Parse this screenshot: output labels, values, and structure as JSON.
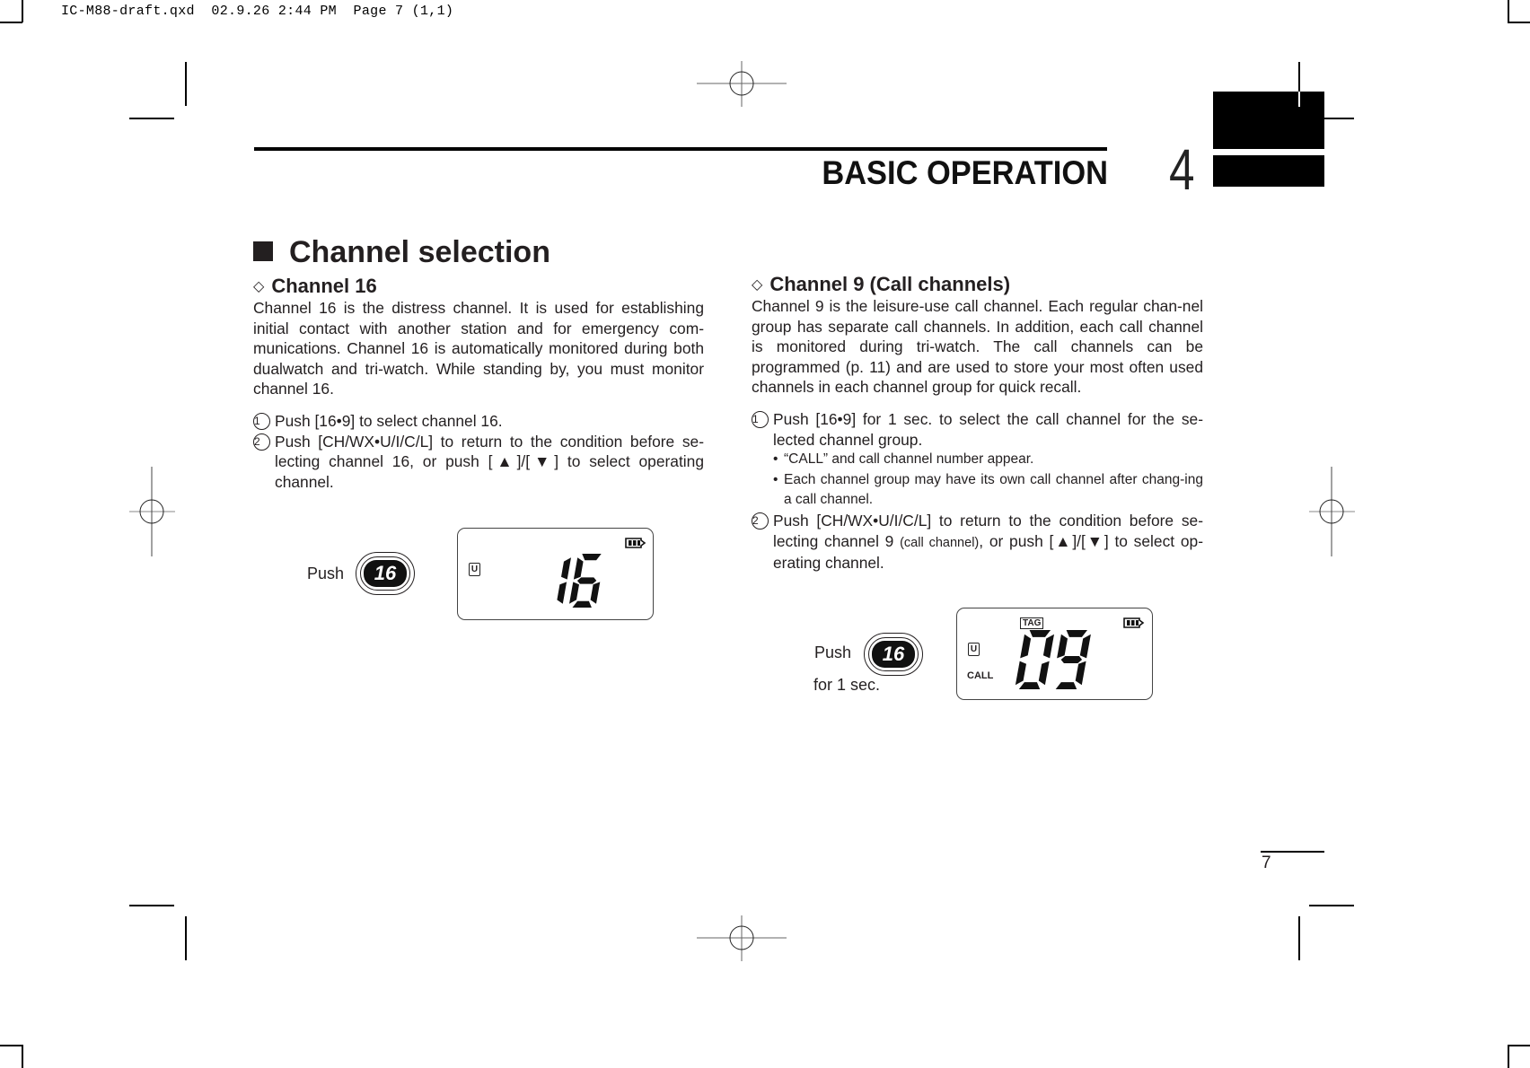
{
  "slug": "IC-M88-draft.qxd  02.9.26 2:44 PM  Page 7 (1,1)",
  "header": {
    "title": "BASIC OPERATION",
    "chapter_number": "4"
  },
  "section": {
    "title": "Channel selection",
    "icon": "square-bullet-icon"
  },
  "left_column": {
    "subhead": "Channel 16",
    "subhead_icon": "diamond-icon",
    "paragraph": "Channel 16 is the distress channel. It is used for establishing initial contact with another station and for emergency com-munications. Channel 16 is automatically monitored during both dualwatch and tri-watch. While standing by, you must monitor channel 16.",
    "steps": [
      {
        "num": "1",
        "text": "Push [16•9] to select channel 16."
      },
      {
        "num": "2",
        "text": "Push [CH/WX•U/I/C/L] to return to the condition before se-lecting channel 16, or push [▲]/[▼] to select operating channel."
      }
    ],
    "illustration": {
      "push_label": "Push",
      "key_label": "16",
      "lcd": {
        "digits": "16",
        "mode_indicator": "U",
        "battery_icon": "battery-icon"
      }
    }
  },
  "right_column": {
    "subhead": "Channel 9 (Call channels)",
    "subhead_icon": "diamond-icon",
    "paragraph": "Channel 9 is the leisure-use call channel. Each regular chan-nel group has separate call channels. In addition, each call channel is monitored during tri-watch. The call channels can be programmed (p. 11) and are used to store your most often used channels in each channel group for quick recall.",
    "steps": [
      {
        "num": "1",
        "text": "Push [16•9] for 1 sec. to select the call channel for the se-lected channel group.",
        "bullets": [
          "“CALL” and call channel number appear.",
          "Each channel group may have its own call channel after chang-ing a call channel."
        ]
      },
      {
        "num": "2",
        "text_before": "Push [CH/WX•U/I/C/L] to return to the condition before se-lecting channel 9 ",
        "text_small": "(call channel)",
        "text_after": ", or push [▲]/[▼] to select op-erating channel."
      }
    ],
    "illustration": {
      "push_label": "Push",
      "push_sublabel": "for 1 sec.",
      "key_label": "16",
      "lcd": {
        "digits": "09",
        "mode_indicator": "U",
        "tag_label": "TAG",
        "call_label": "CALL",
        "battery_icon": "battery-icon"
      }
    }
  },
  "footer": {
    "page_number": "7"
  }
}
